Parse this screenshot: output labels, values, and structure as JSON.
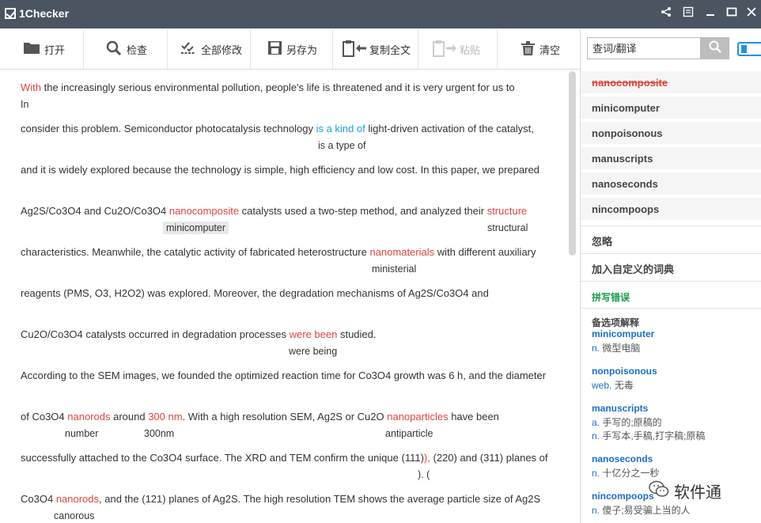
{
  "app": {
    "title": "1Checker"
  },
  "toolbar": {
    "open": "打开",
    "check": "检查",
    "fix_all": "全部修改",
    "save_as": "另存为",
    "copy_all": "复制全文",
    "paste": "粘贴",
    "clear": "清空"
  },
  "search": {
    "placeholder": "查词/翻译"
  },
  "editor": {
    "l1": {
      "a": "With",
      "b": " the increasingly serious environmental pollution, people's life is threatened and it is very urgent for us to"
    },
    "l1b": "In",
    "l2": {
      "a": "consider this problem. Semiconductor photocatalysis technology ",
      "b": "is a kind of",
      "c": " light-driven activation of the catalyst,"
    },
    "l2s": "is a type of",
    "l3": "and it is widely explored because the technology is simple, high efficiency and low cost. In this paper, we prepared",
    "l4": {
      "a": "Ag2S/Co3O4 and Cu2O/Co3O4 ",
      "b": "nanocomposite",
      "c": " catalysts used a two-step method, and analyzed their ",
      "d": "structure"
    },
    "l4s1": "minicomputer",
    "l4s2": "structural",
    "l5": {
      "a": "characteristics. Meanwhile, the catalytic activity of fabricated heterostructure ",
      "b": "nanomaterials",
      "c": " with different auxiliary"
    },
    "l5s": "ministerial",
    "l6": "reagents (PMS, O3, H2O2) was explored. Moreover, the degradation mechanisms of Ag2S/Co3O4 and",
    "l7": {
      "a": "Cu2O/Co3O4 catalysts occurred in degradation processes ",
      "b": "were been",
      "c": " studied."
    },
    "l7s": "were being",
    "l8": "According to the SEM images, we founded the optimized reaction time for Co3O4 growth was 6 h, and the diameter",
    "l9": {
      "a": "of Co3O4 ",
      "b": "nanorods",
      "c": " around ",
      "d": "300 nm",
      "e": ". With a high resolution SEM, Ag2S or Cu2O ",
      "f": "nanoparticles",
      "g": " have been"
    },
    "l9s1": "number",
    "l9s2": "300nm",
    "l9s3": "antiparticle",
    "l10": {
      "a": "successfully attached to the Co3O4 surface. The XRD and TEM confirm the unique (111)",
      "b": "),",
      "c": " (220) and (311) planes of"
    },
    "l10s": "). (",
    "l11": {
      "a": "Co3O4 ",
      "b": "nanorods",
      "c": ", and the (121) planes of Ag2S. The high resolution TEM shows the average particle size of Ag2S"
    },
    "l11s": "canorous"
  },
  "suggestions": {
    "current": "nanocomposite",
    "items": [
      "minicomputer",
      "nonpoisonous",
      "manuscripts",
      "nanoseconds",
      "nincompoops"
    ],
    "ignore": "忽略",
    "add_dict": "加入自定义的词典",
    "error_type": "拼写错误",
    "glossary_title": "备选项解释",
    "glossary": [
      {
        "word": "minicomputer",
        "defs": [
          {
            "pos": "n.",
            "text": " 微型电脑"
          }
        ]
      },
      {
        "word": "nonpoisonous",
        "defs": [
          {
            "pos": "web.",
            "text": " 无毒"
          }
        ]
      },
      {
        "word": "manuscripts",
        "defs": [
          {
            "pos": "a.",
            "text": " 手写的;原稿的"
          },
          {
            "pos": "n.",
            "text": " 手写本,手稿,打字稿;原稿"
          }
        ]
      },
      {
        "word": "nanoseconds",
        "defs": [
          {
            "pos": "n.",
            "text": " 十亿分之一秒"
          }
        ]
      },
      {
        "word": "nincompoops",
        "defs": [
          {
            "pos": "n.",
            "text": " 傻子;易受骗上当的人"
          }
        ]
      }
    ]
  },
  "watermark": {
    "text": "软件通"
  }
}
